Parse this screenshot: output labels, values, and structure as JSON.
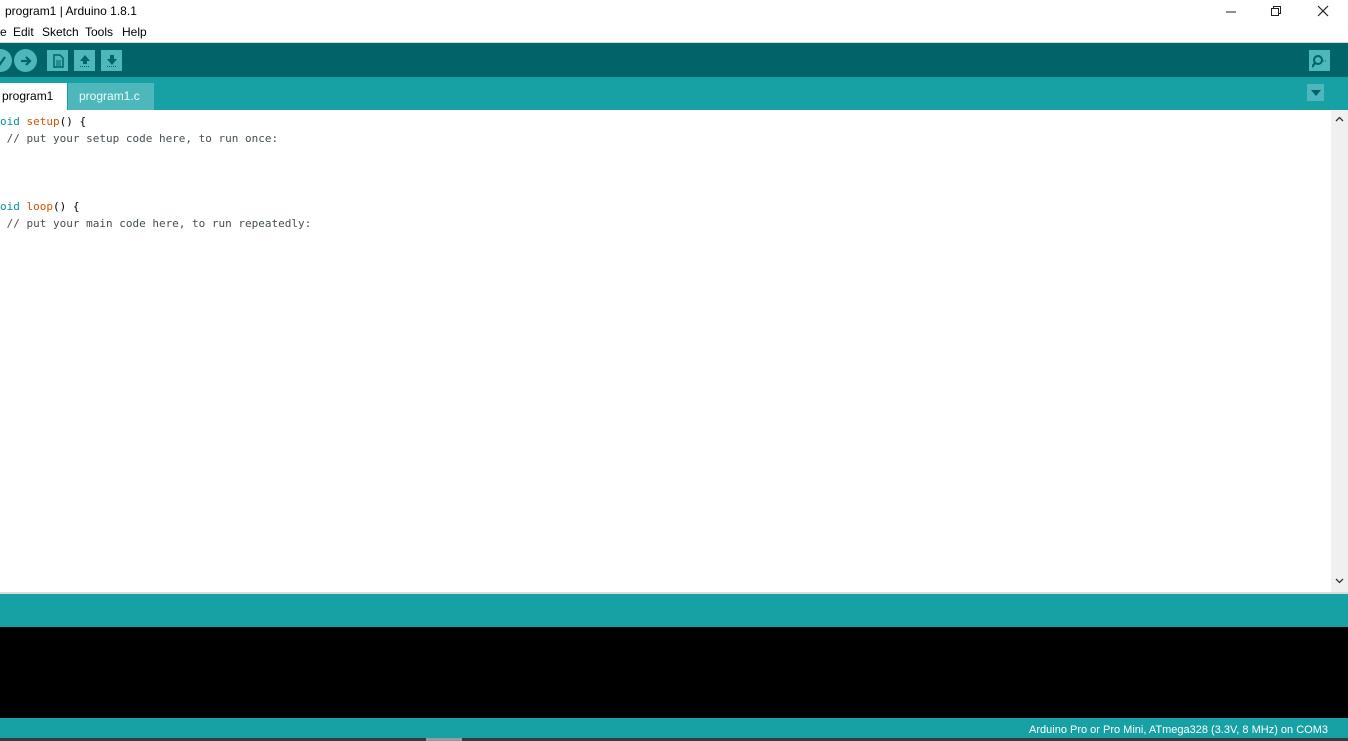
{
  "window": {
    "title": "program1 | Arduino 1.8.1",
    "controls": [
      "minimize-icon",
      "restore-icon",
      "close-icon"
    ]
  },
  "menu": {
    "file": "e",
    "edit": "Edit",
    "sketch": "Sketch",
    "tools": "Tools",
    "help": "Help"
  },
  "toolbar": {
    "buttons": [
      "verify-icon",
      "upload-icon",
      "new-icon",
      "open-icon",
      "save-icon",
      "serial-monitor-icon"
    ]
  },
  "tabs": [
    {
      "label": "program1",
      "active": true
    },
    {
      "label": "program1.c",
      "active": false
    }
  ],
  "editor": {
    "lines": [
      {
        "kw": "oid",
        "fn": "setup",
        "rest": "() {"
      },
      {
        "comment": " // put your setup code here, to run once:"
      },
      {
        "text": ""
      },
      {
        "text": ""
      },
      {
        "text": ""
      },
      {
        "kw": "oid",
        "fn": "loop",
        "rest": "() {"
      },
      {
        "comment": " // put your main code here, to run repeatedly:"
      }
    ]
  },
  "footer": {
    "board": "Arduino Pro or Pro Mini, ATmega328 (3.3V, 8 MHz) on COM3"
  },
  "colors": {
    "toolbar": "#006468",
    "tabbar": "#17a1a5",
    "button": "#4db7bb",
    "keyword": "#00979c",
    "function": "#d35400",
    "comment": "#434f54"
  }
}
